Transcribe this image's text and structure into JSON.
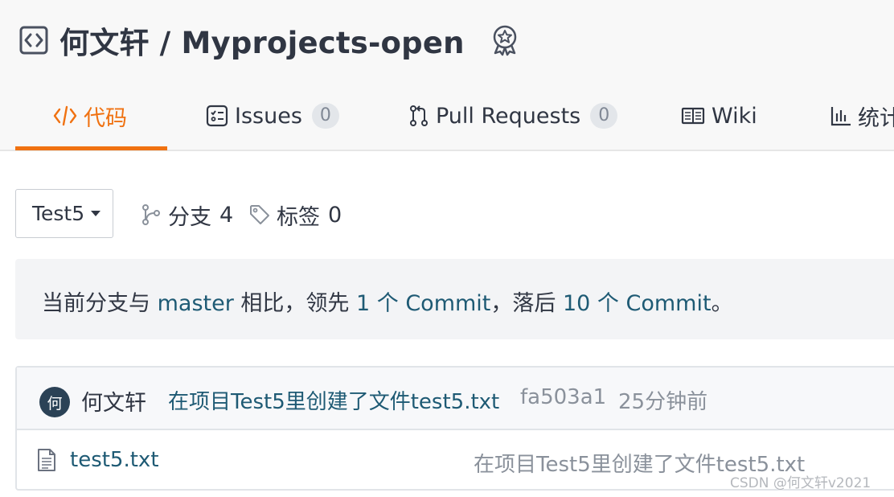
{
  "repo": {
    "title": "何文轩 / Myprojects-open",
    "icon": "code-box-icon",
    "badge_icon": "award-badge-icon"
  },
  "tabs": [
    {
      "label": "代码",
      "icon": "code-icon",
      "active": true
    },
    {
      "label": "Issues",
      "icon": "issues-icon",
      "count": "0"
    },
    {
      "label": "Pull Requests",
      "icon": "pull-request-icon",
      "count": "0"
    },
    {
      "label": "Wiki",
      "icon": "book-icon"
    },
    {
      "label": "统计",
      "icon": "bar-chart-icon"
    }
  ],
  "branch": {
    "selected": "Test5",
    "branches_label": "分支",
    "branches_count": "4",
    "tags_label": "标签",
    "tags_count": "0"
  },
  "compare": {
    "prefix": "当前分支与 ",
    "base_branch": "master",
    "middle1": " 相比，领先 ",
    "ahead": "1 个 Commit",
    "middle2": "，落后 ",
    "behind": "10 个 Commit",
    "suffix": "。"
  },
  "latest_commit": {
    "avatar_text": "何",
    "author": "何文轩",
    "message": "在项目Test5里创建了文件test5.txt",
    "hash": "fa503a1",
    "time": "25分钟前"
  },
  "files": [
    {
      "name": "test5.txt",
      "icon": "file-text-icon",
      "last_commit": "在项目Test5里创建了文件test5.txt"
    }
  ],
  "watermark": "CSDN @何文轩v2021",
  "colors": {
    "accent": "#f07212",
    "link": "#1e5a74",
    "muted": "#8a919b",
    "header_bg": "#f8f8f8"
  }
}
